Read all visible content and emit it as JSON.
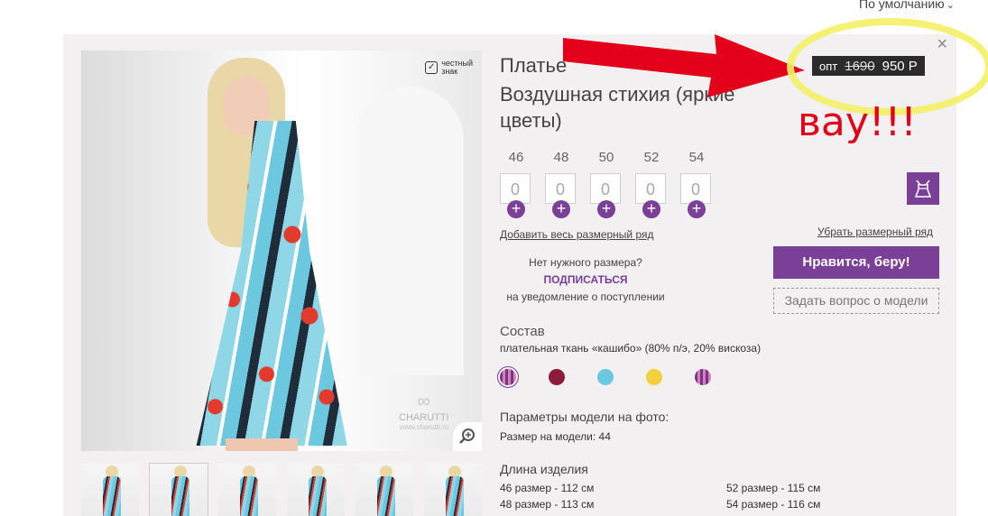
{
  "sort": {
    "label": "По умолчанию"
  },
  "product": {
    "title_line1": "Платье",
    "title_line2": "Воздушная стихия (яркие цветы)",
    "honest_mark": {
      "line1": "честный",
      "line2": "знак"
    },
    "brand": "CHARUTTI",
    "brand_site": "www.charutti.ru",
    "price": {
      "label": "опт",
      "old": "1690",
      "new": "950 Р"
    },
    "sizes": [
      {
        "size": "46",
        "qty": "0"
      },
      {
        "size": "48",
        "qty": "0"
      },
      {
        "size": "50",
        "qty": "0"
      },
      {
        "size": "52",
        "qty": "0"
      },
      {
        "size": "54",
        "qty": "0"
      }
    ],
    "add_row_label": "Добавить весь размерный ряд",
    "remove_row_label": "Убрать размерный ряд",
    "no_size": {
      "line1": "Нет нужного размера?",
      "subscribe": "ПОДПИСАТЬСЯ",
      "line2": "на уведомление о поступлении"
    },
    "buy_label": "Нравится, беру!",
    "ask_label": "Задать вопрос о модели",
    "composition": {
      "heading": "Состав",
      "text": "плательная ткань «кашибо» (80% п/э, 20% вискоза)"
    },
    "colors": [
      "#6a3a8f",
      "#8b1c3a",
      "#6cc8df",
      "#f4d03f",
      "#6a3a8f"
    ],
    "params": {
      "heading": "Параметры модели на фото:",
      "text": "Размер на модели: 44"
    },
    "length": {
      "heading": "Длина изделия",
      "left": [
        "46 размер - 112 см",
        "48 размер - 113 см"
      ],
      "right": [
        "52 размер - 115 см",
        "54 размер - 116 см"
      ]
    }
  },
  "annotation": {
    "text": "вау!!!"
  }
}
